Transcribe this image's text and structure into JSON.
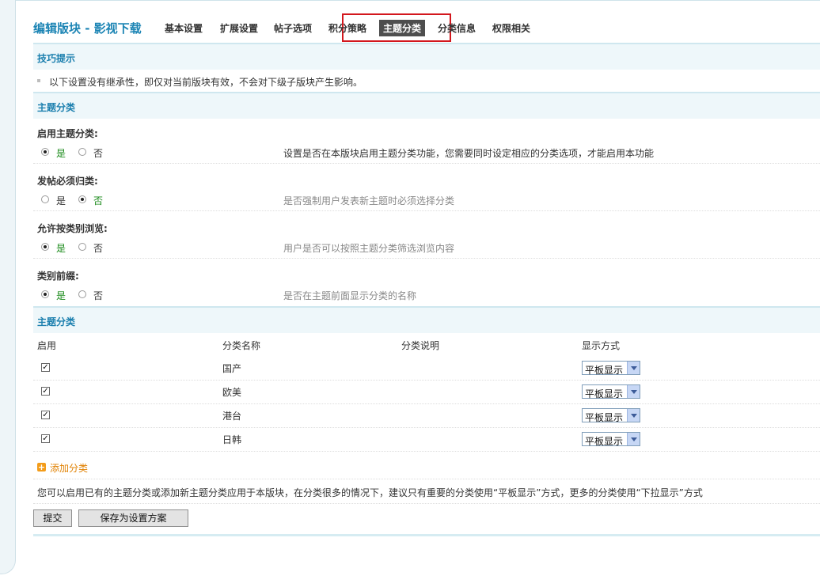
{
  "nav": {
    "title": "编辑版块 - 影视下载",
    "tabs": [
      {
        "label": "基本设置"
      },
      {
        "label": "扩展设置"
      },
      {
        "label": "帖子选项"
      },
      {
        "label": "积分策略"
      },
      {
        "label": "主题分类",
        "active": true
      },
      {
        "label": "分类信息"
      },
      {
        "label": "权限相关"
      }
    ]
  },
  "tips": {
    "header": "技巧提示",
    "text": "以下设置没有继承性，即仅对当前版块有效，不会对下级子版块产生影响。"
  },
  "settings": {
    "header": "主题分类",
    "options": [
      {
        "label": "启用主题分类:",
        "yes": "是",
        "no": "否",
        "selected": "yes",
        "desc": "设置是否在本版块启用主题分类功能，您需要同时设定相应的分类选项，才能启用本功能"
      },
      {
        "label": "发帖必须归类:",
        "yes": "是",
        "no": "否",
        "selected": "no",
        "desc": "是否强制用户发表新主题时必须选择分类"
      },
      {
        "label": "允许按类别浏览:",
        "yes": "是",
        "no": "否",
        "selected": "yes",
        "desc": "用户是否可以按照主题分类筛选浏览内容"
      },
      {
        "label": "类别前缀:",
        "yes": "是",
        "no": "否",
        "selected": "yes",
        "desc": "是否在主题前面显示分类的名称"
      }
    ]
  },
  "categories": {
    "header": "主题分类",
    "columns": [
      "启用",
      "分类名称",
      "分类说明",
      "显示方式"
    ],
    "rows": [
      {
        "enabled": true,
        "name": "国产",
        "display": "平板显示"
      },
      {
        "enabled": true,
        "name": "欧美",
        "display": "平板显示"
      },
      {
        "enabled": true,
        "name": "港台",
        "display": "平板显示"
      },
      {
        "enabled": true,
        "name": "日韩",
        "display": "平板显示"
      }
    ],
    "add_label": "添加分类",
    "note": "您可以启用已有的主题分类或添加新主题分类应用于本版块，在分类很多的情况下，建议只有重要的分类使用“平板显示”方式，更多的分类使用“下拉显示”方式"
  },
  "buttons": {
    "submit": "提交",
    "save_scheme": "保存为设置方案"
  }
}
